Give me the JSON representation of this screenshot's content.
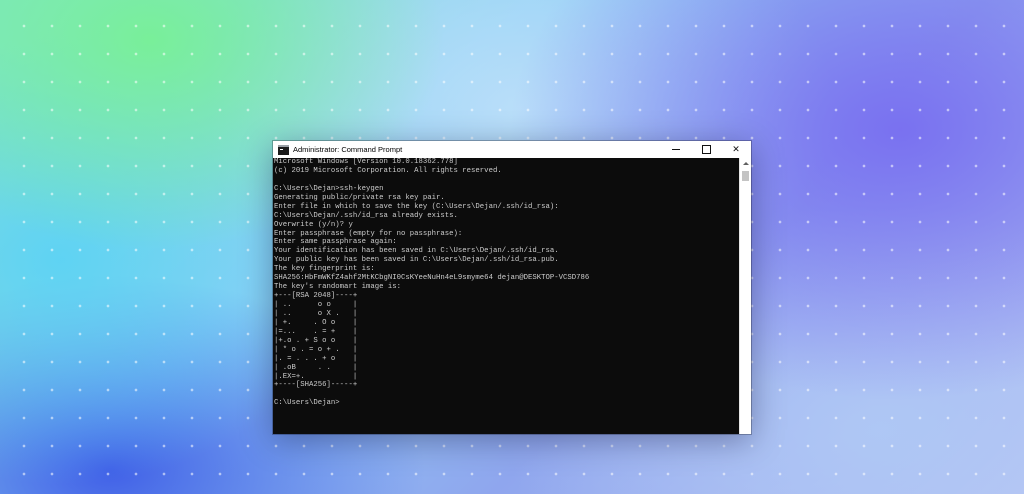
{
  "window": {
    "title": "Administrator: Command Prompt",
    "controls": {
      "minimize": "minimize",
      "maximize": "maximize",
      "close": "✕"
    }
  },
  "terminal": {
    "lines": [
      "Microsoft Windows [Version 10.0.18362.778]",
      "(c) 2019 Microsoft Corporation. All rights reserved.",
      "",
      "C:\\Users\\Dejan>ssh-keygen",
      "Generating public/private rsa key pair.",
      "Enter file in which to save the key (C:\\Users\\Dejan/.ssh/id_rsa):",
      "C:\\Users\\Dejan/.ssh/id_rsa already exists.",
      "Overwrite (y/n)? y",
      "Enter passphrase (empty for no passphrase):",
      "Enter same passphrase again:",
      "Your identification has been saved in C:\\Users\\Dejan/.ssh/id_rsa.",
      "Your public key has been saved in C:\\Users\\Dejan/.ssh/id_rsa.pub.",
      "The key fingerprint is:",
      "SHA256:HbFmWKfZ4ahf2MtKCbgNI0CsKYeeNuHn4eL9smyme64 dejan@DESKTOP-VCSD786",
      "The key's randomart image is:",
      "+---[RSA 2048]----+",
      "| ..      o o     |",
      "| ..      o X .   |",
      "| +.     . O o    |",
      "|=...    . = +    |",
      "|+.o . + S o o    |",
      "| * o . = o + .   |",
      "|. = . . . + o    |",
      "| .oB     . .     |",
      "|.EX=+.           |",
      "+----[SHA256]-----+",
      "",
      "C:\\Users\\Dejan>"
    ]
  },
  "colors": {
    "console_bg": "#0c0c0c",
    "console_text": "#cccccc",
    "titlebar_bg": "#ffffff"
  }
}
